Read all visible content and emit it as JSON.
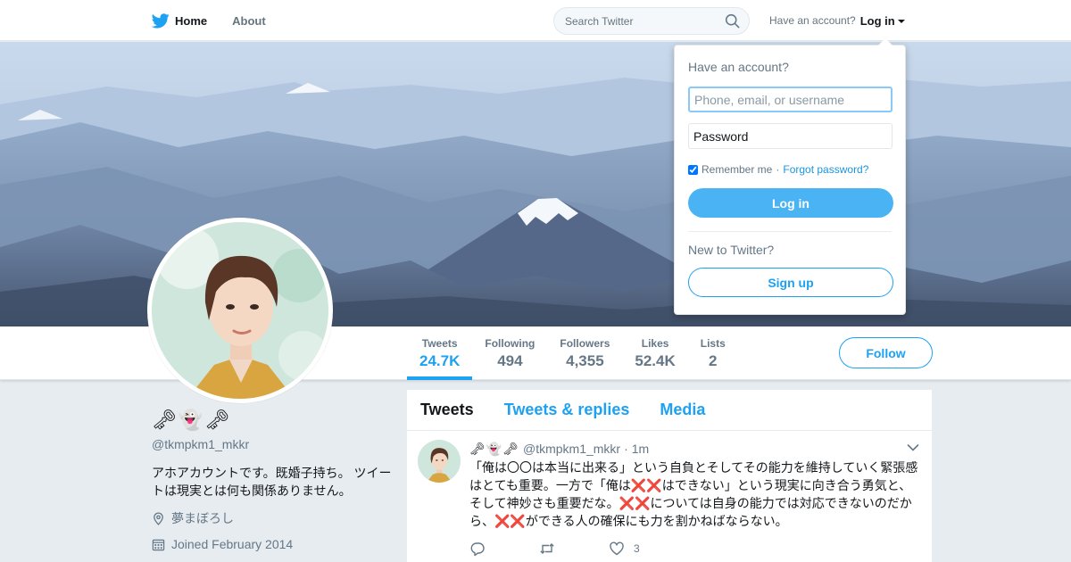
{
  "nav": {
    "home_label": "Home",
    "about_label": "About",
    "logo_icon": "twitter-bird-icon",
    "brand_color": "#1da1f2"
  },
  "search": {
    "placeholder": "Search Twitter",
    "icon": "search-icon"
  },
  "account": {
    "prompt": "Have an account?",
    "login_label": "Log in"
  },
  "stats": [
    {
      "label": "Tweets",
      "value": "24.7K"
    },
    {
      "label": "Following",
      "value": "494"
    },
    {
      "label": "Followers",
      "value": "4,355"
    },
    {
      "label": "Likes",
      "value": "52.4K"
    },
    {
      "label": "Lists",
      "value": "2"
    }
  ],
  "follow_label": "Follow",
  "profile": {
    "display_name": "🗝👻🗝",
    "screen_name": "@tkmpkm1_mkkr",
    "bio": "アホアカウントです。既婚子持ち。 ツイートは現実とは何も関係ありません。",
    "location": "夢まぼろし",
    "joined": "Joined February 2014"
  },
  "timeline": {
    "tabs": [
      "Tweets",
      "Tweets & replies",
      "Media"
    ],
    "tweet": {
      "name": "🗝👻🗝",
      "handle": "@tkmpkm1_mkkr",
      "dot": "·",
      "time": "1m",
      "text": "「俺は〇〇は本当に出来る」という自負とそしてその能力を維持していく緊張感はとても重要。一方で「俺は❌❌はできない」という現実に向き合う勇気と、そして神妙さも重要だな。❌❌については自身の能力では対応できないのだから、❌❌ができる人の確保にも力を割かねばならない。",
      "like_count": "3"
    }
  },
  "login_dropdown": {
    "heading": "Have an account?",
    "username_placeholder": "Phone, email, or username",
    "password_placeholder": "Password",
    "remember_label": "Remember me",
    "separator": "·",
    "forgot_label": "Forgot password?",
    "login_button": "Log in",
    "new_prompt": "New to Twitter?",
    "signup_button": "Sign up"
  }
}
